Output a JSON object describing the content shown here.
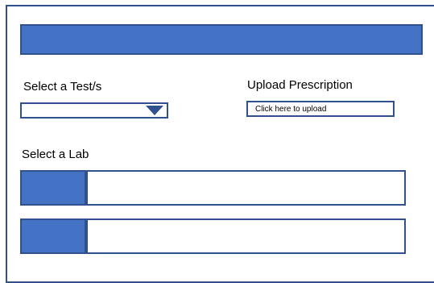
{
  "header": {
    "title": ""
  },
  "test_selection": {
    "label": "Select a Test/s",
    "selected_value": "",
    "icon": "chevron-down-icon"
  },
  "prescription": {
    "label": "Upload Prescription",
    "button_label": "Click here to upload"
  },
  "lab_selection": {
    "label": "Select a Lab",
    "labs": [
      {
        "name": ""
      },
      {
        "name": ""
      }
    ]
  },
  "colors": {
    "accent": "#4472c4",
    "border": "#2f528f",
    "background": "#ffffff"
  }
}
